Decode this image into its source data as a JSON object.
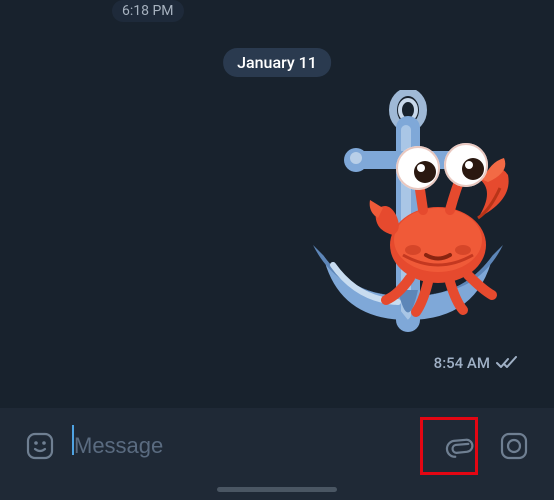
{
  "chat": {
    "prev_time": "6:18 PM",
    "date_separator": "January 11",
    "sticker": {
      "semantic": "crab-on-anchor-sticker"
    },
    "msg_time": "8:54 AM",
    "read_status": "read"
  },
  "composer": {
    "placeholder": "Message",
    "value": ""
  },
  "icons": {
    "emoji": "emoji-icon",
    "attach": "attach-icon",
    "camera": "camera-icon",
    "checks": "double-check-icon"
  }
}
